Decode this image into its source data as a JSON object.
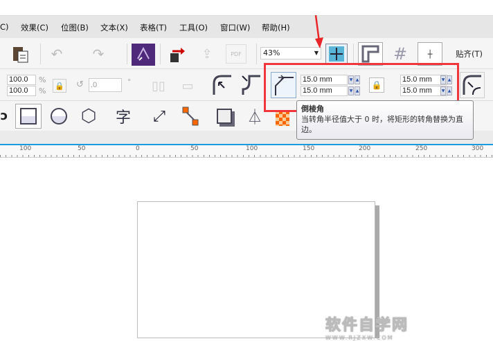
{
  "menu": [
    "C)",
    "效果(C)",
    "位图(B)",
    "文本(X)",
    "表格(T)",
    "工具(O)",
    "窗口(W)",
    "帮助(H)"
  ],
  "toolbar": {
    "zoom": "43%",
    "snap": "贴齐(T)"
  },
  "property_bar": {
    "scale_x": "100.0",
    "scale_y": "100.0",
    "pct": "%",
    "rotation": ".0",
    "degree": "°",
    "corner_tl": "15.0 mm",
    "corner_bl": "15.0 mm",
    "corner_tr": "15.0 mm",
    "corner_br": "15.0 mm"
  },
  "tooltip": {
    "title": "倒棱角",
    "body": "当转角半径值大于 0 时，将矩形的转角替换为直边。"
  },
  "ruler": [
    "100",
    "50",
    "0",
    "50",
    "100",
    "150",
    "200",
    "250",
    "300"
  ],
  "watermark": {
    "line1": "软件自学网",
    "line2": "WWW.RJZXW.COM"
  },
  "colors": {
    "highlight": "#f0353b",
    "arrow": "#e8262a",
    "ruler_accent": "#1a9be0"
  }
}
